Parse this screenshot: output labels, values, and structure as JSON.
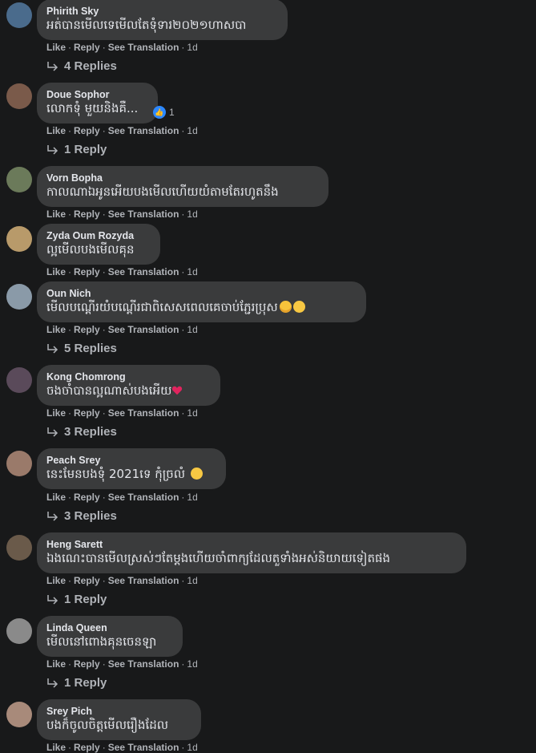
{
  "actions": {
    "like": "Like",
    "reply": "Reply",
    "translate": "See Translation",
    "sep": "·"
  },
  "comments": [
    {
      "author": "Phirith Sky",
      "text": "អត់បានមើលទេមើលតែទុំទារ២០២១ហាសបា",
      "time": "1d",
      "replies": "4 Replies",
      "avatar_color": "#4a6b8c"
    },
    {
      "author": "Doue Sophor",
      "text": "លោកទុំ មួយនិងគឺ...",
      "time": "1d",
      "replies": "1 Reply",
      "reactions": "1",
      "avatar_color": "#7a5a4a"
    },
    {
      "author": "Vorn Bopha",
      "text": "កាលណាឯអូនអើយបងមើលហើយយំតាមតែរហូតនឹង",
      "time": "1d",
      "avatar_color": "#6b7a5a"
    },
    {
      "author": "Zyda Oum Rozyda",
      "text": "ល្អមើលបងមើលគុន",
      "time": "1d",
      "avatar_color": "#b89a6a"
    },
    {
      "author": "Oun Nich",
      "text": "មើលបណ្ដើរយំបណ្ដើរជាពិសេសពេលគេចាប់ភ្ជែរប្រុស",
      "time": "1d",
      "replies": "5 Replies",
      "avatar_color": "#8a9aa8"
    },
    {
      "author": "Kong Chomrong",
      "text": "ចងចាំបានល្អណាស់បងអើយ",
      "time": "1d",
      "replies": "3 Replies",
      "avatar_color": "#5a4a5a"
    },
    {
      "author": "Peach Srey",
      "text": "នេះមែនបងទុំ 2021ទេ កុំច្រលំ",
      "time": "1d",
      "replies": "3 Replies",
      "avatar_color": "#9a7a6a"
    },
    {
      "author": "Heng Sarett",
      "text": "ឯងណេះបានមើលស្រស់ៗតែម្ដងហើយចាំពាក្យដែលតួទាំងអស់និយាយទៀតផង",
      "time": "1d",
      "replies": "1 Reply",
      "avatar_color": "#6a5a4a"
    },
    {
      "author": "Linda Queen",
      "text": "មើលនៅពេាងគុនចេនឡា",
      "time": "1d",
      "replies": "1 Reply",
      "avatar_color": "#8a8a8a"
    },
    {
      "author": "Srey Pich",
      "text": "បងក៏ចូលចិត្តមើលរឿងដែល",
      "time": "1d",
      "avatar_color": "#a88a7a"
    }
  ]
}
